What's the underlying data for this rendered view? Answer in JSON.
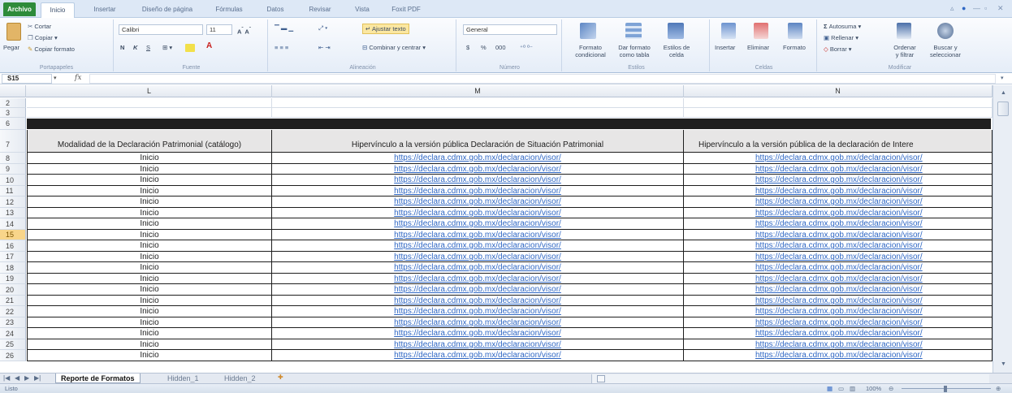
{
  "ribbon": {
    "tabs": [
      "Archivo",
      "Inicio",
      "Insertar",
      "Diseño de página",
      "Fórmulas",
      "Datos",
      "Revisar",
      "Vista",
      "Foxit PDF"
    ],
    "clipboard": {
      "paste": "Pegar",
      "cut": "Cortar",
      "copy": "Copiar",
      "copy_format": "Copiar formato",
      "label": "Portapapeles"
    },
    "font": {
      "name": "Calibri",
      "size": "11",
      "bold": "N",
      "italic": "K",
      "underline": "S",
      "label": "Fuente"
    },
    "alignment": {
      "wrap": "Ajustar texto",
      "merge": "Combinar y centrar",
      "label": "Alineación"
    },
    "number": {
      "format": "General",
      "currency": "$",
      "percent": "%",
      "thousands": "000",
      "label": "Número"
    },
    "styles": {
      "conditional": "Formato",
      "conditional2": "condicional",
      "table": "Dar formato",
      "table2": "como tabla",
      "cell": "Estilos de",
      "cell2": "celda",
      "label": "Estilos"
    },
    "cells": {
      "insert": "Insertar",
      "delete": "Eliminar",
      "format": "Formato",
      "label": "Celdas"
    },
    "editing": {
      "autosum": "Autosuma",
      "fill": "Rellenar",
      "clear": "Borrar",
      "sort": "Ordenar",
      "sort2": "y filtrar",
      "find": "Buscar y",
      "find2": "seleccionar",
      "label": "Modificar"
    }
  },
  "formula_bar": {
    "name_box": "S15",
    "fx": "fx",
    "content": ""
  },
  "columns": [
    "L",
    "M",
    "N"
  ],
  "header_rows": [
    "2",
    "3",
    "6",
    "7"
  ],
  "table_headers": [
    "Modalidad de la Declaración Patrimonial (catálogo)",
    "Hipervínculo a la versión pública Declaración de Situación Patrimonial",
    "Hipervínculo a la versión pública de la declaración de Intere"
  ],
  "rows": [
    {
      "num": "8",
      "modalidad": "Inicio",
      "link_m": "https://declara.cdmx.gob.mx/declaracion/visor/",
      "link_n": "https://declara.cdmx.gob.mx/declaracion/visor/"
    },
    {
      "num": "9",
      "modalidad": "Inicio",
      "link_m": "https://declara.cdmx.gob.mx/declaracion/visor/",
      "link_n": "https://declara.cdmx.gob.mx/declaracion/visor/"
    },
    {
      "num": "10",
      "modalidad": "Inicio",
      "link_m": "https://declara.cdmx.gob.mx/declaracion/visor/",
      "link_n": "https://declara.cdmx.gob.mx/declaracion/visor/"
    },
    {
      "num": "11",
      "modalidad": "Inicio",
      "link_m": "https://declara.cdmx.gob.mx/declaracion/visor/",
      "link_n": "https://declara.cdmx.gob.mx/declaracion/visor/"
    },
    {
      "num": "12",
      "modalidad": "Inicio",
      "link_m": "https://declara.cdmx.gob.mx/declaracion/visor/",
      "link_n": "https://declara.cdmx.gob.mx/declaracion/visor/"
    },
    {
      "num": "13",
      "modalidad": "Inicio",
      "link_m": "https://declara.cdmx.gob.mx/declaracion/visor/",
      "link_n": "https://declara.cdmx.gob.mx/declaracion/visor/"
    },
    {
      "num": "14",
      "modalidad": "Inicio",
      "link_m": "https://declara.cdmx.gob.mx/declaracion/visor/",
      "link_n": "https://declara.cdmx.gob.mx/declaracion/visor/"
    },
    {
      "num": "15",
      "modalidad": "Inicio",
      "link_m": "https://declara.cdmx.gob.mx/declaracion/visor/",
      "link_n": "https://declara.cdmx.gob.mx/declaracion/visor/"
    },
    {
      "num": "16",
      "modalidad": "Inicio",
      "link_m": "https://declara.cdmx.gob.mx/declaracion/visor/",
      "link_n": "https://declara.cdmx.gob.mx/declaracion/visor/"
    },
    {
      "num": "17",
      "modalidad": "Inicio",
      "link_m": "https://declara.cdmx.gob.mx/declaracion/visor/",
      "link_n": "https://declara.cdmx.gob.mx/declaracion/visor/"
    },
    {
      "num": "18",
      "modalidad": "Inicio",
      "link_m": "https://declara.cdmx.gob.mx/declaracion/visor/",
      "link_n": "https://declara.cdmx.gob.mx/declaracion/visor/"
    },
    {
      "num": "19",
      "modalidad": "Inicio",
      "link_m": "https://declara.cdmx.gob.mx/declaracion/visor/",
      "link_n": "https://declara.cdmx.gob.mx/declaracion/visor/"
    },
    {
      "num": "20",
      "modalidad": "Inicio",
      "link_m": "https://declara.cdmx.gob.mx/declaracion/visor/",
      "link_n": "https://declara.cdmx.gob.mx/declaracion/visor/"
    },
    {
      "num": "21",
      "modalidad": "Inicio",
      "link_m": "https://declara.cdmx.gob.mx/declaracion/visor/",
      "link_n": "https://declara.cdmx.gob.mx/declaracion/visor/"
    },
    {
      "num": "22",
      "modalidad": "Inicio",
      "link_m": "https://declara.cdmx.gob.mx/declaracion/visor/",
      "link_n": "https://declara.cdmx.gob.mx/declaracion/visor/"
    },
    {
      "num": "23",
      "modalidad": "Inicio",
      "link_m": "https://declara.cdmx.gob.mx/declaracion/visor/",
      "link_n": "https://declara.cdmx.gob.mx/declaracion/visor/"
    },
    {
      "num": "24",
      "modalidad": "Inicio",
      "link_m": "https://declara.cdmx.gob.mx/declaracion/visor/",
      "link_n": "https://declara.cdmx.gob.mx/declaracion/visor/"
    },
    {
      "num": "25",
      "modalidad": "Inicio",
      "link_m": "https://declara.cdmx.gob.mx/declaracion/visor/",
      "link_n": "https://declara.cdmx.gob.mx/declaracion/visor/"
    },
    {
      "num": "26",
      "modalidad": "Inicio",
      "link_m": "https://declara.cdmx.gob.mx/declaracion/visor/",
      "link_n": "https://declara.cdmx.gob.mx/declaracion/visor/"
    }
  ],
  "selected_row": "15",
  "sheet_tabs": [
    "Reporte de Formatos",
    "Hidden_1",
    "Hidden_2"
  ],
  "status": {
    "mode": "Listo",
    "zoom": "100%"
  },
  "colors": {
    "accent": "#2e8b3a",
    "link": "#2f67c4",
    "band": "#1f1f1f",
    "selected_row": "#f8d58a"
  }
}
